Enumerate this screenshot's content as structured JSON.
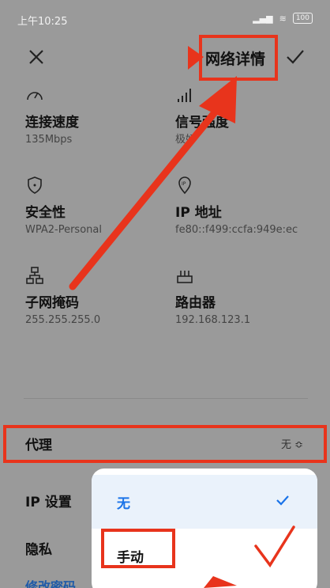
{
  "status": {
    "time": "上午10:25",
    "battery": "100"
  },
  "header": {
    "title": "网络详情"
  },
  "info": [
    {
      "label": "连接速度",
      "value": "135Mbps",
      "icon": "speedometer-icon"
    },
    {
      "label": "信号强度",
      "value": "极好",
      "icon": "signal-icon"
    },
    {
      "label": "安全性",
      "value": "WPA2-Personal",
      "icon": "shield-icon"
    },
    {
      "label": "IP 地址",
      "value": "fe80::f499:ccfa:949e:ec",
      "icon": "ip-pin-icon"
    },
    {
      "label": "子网掩码",
      "value": "255.255.255.0",
      "icon": "network-tree-icon"
    },
    {
      "label": "路由器",
      "value": "192.168.123.1",
      "icon": "router-icon"
    }
  ],
  "settings": {
    "proxy_label": "代理",
    "proxy_value": "无 ≎",
    "ip_label": "IP 设置",
    "privacy_label": "隐私",
    "change_password": "修改密码"
  },
  "popup": {
    "options": [
      {
        "label": "无",
        "selected": true
      },
      {
        "label": "手动",
        "selected": false
      }
    ]
  },
  "colors": {
    "accent": "#1a73e8",
    "annotation": "#e8341c"
  }
}
